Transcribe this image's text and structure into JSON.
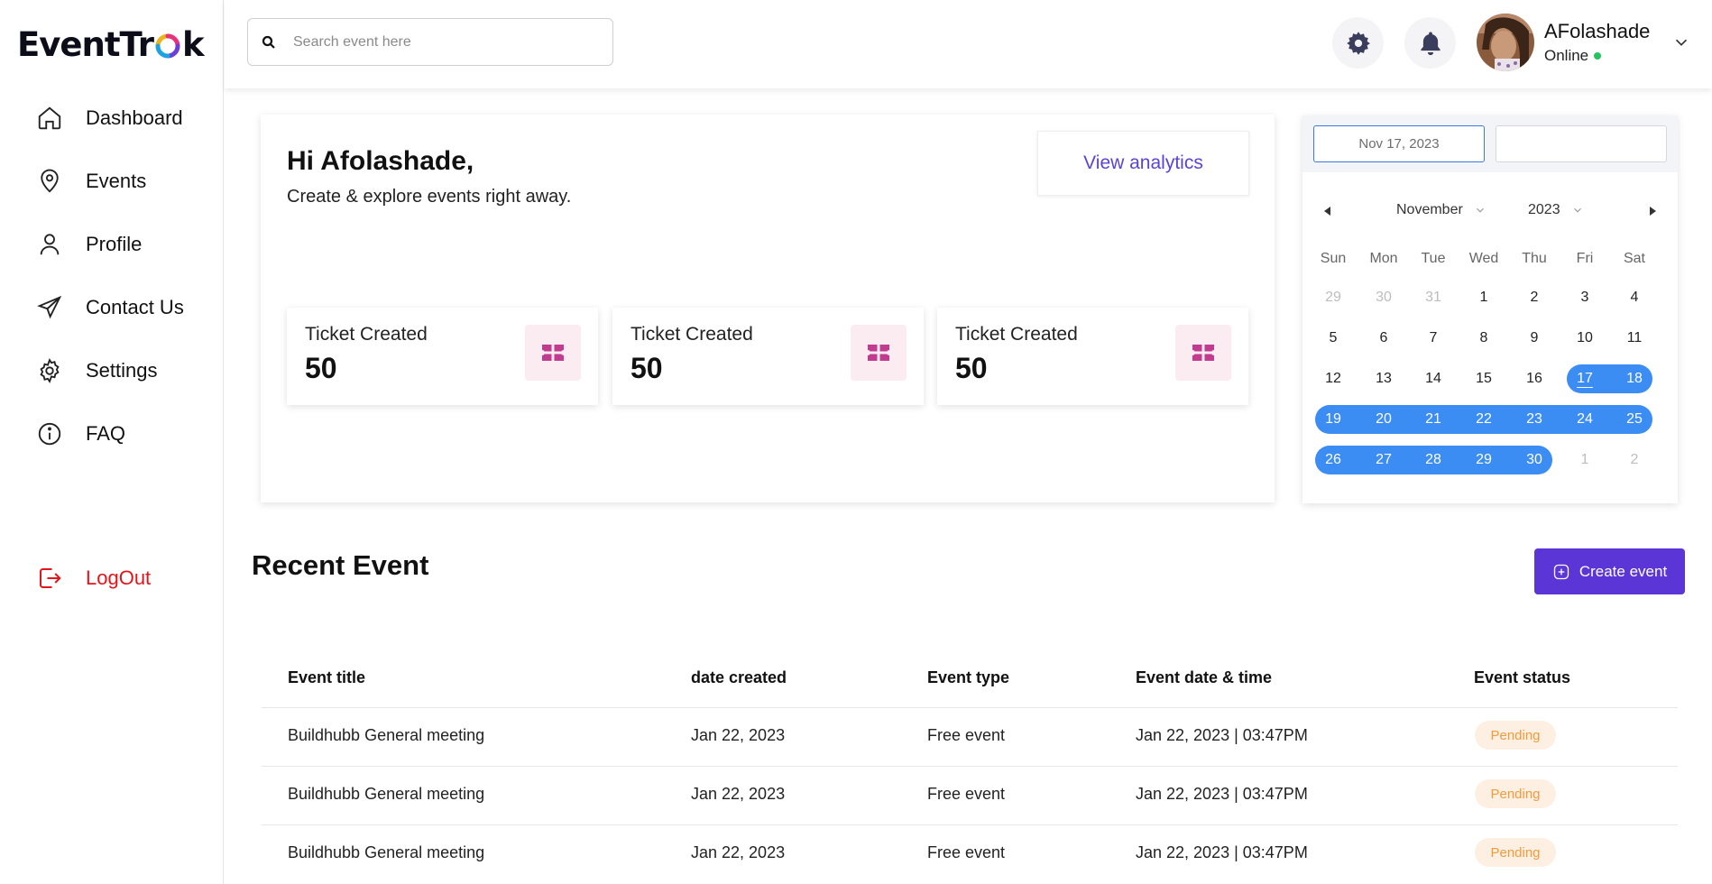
{
  "app": {
    "brand": "EventTrak",
    "brand_prefix": "EventTr",
    "brand_suffix": "k",
    "accent": "#5b35d5",
    "danger": "#e4141a"
  },
  "sidebar": {
    "items": [
      {
        "label": "Dashboard",
        "icon": "home-icon"
      },
      {
        "label": "Events",
        "icon": "location-pin-icon"
      },
      {
        "label": "Profile",
        "icon": "user-icon"
      },
      {
        "label": "Contact Us",
        "icon": "send-icon"
      },
      {
        "label": "Settings",
        "icon": "gear-icon"
      },
      {
        "label": "FAQ",
        "icon": "info-icon"
      }
    ],
    "logout": {
      "label": "LogOut",
      "icon": "logout-icon"
    }
  },
  "header": {
    "search_placeholder": "Search event here",
    "user_name": "AFolashade",
    "user_status": "Online",
    "status_color": "#22c55e"
  },
  "welcome": {
    "greeting": "Hi Afolashade,",
    "subtitle": "Create & explore events right away.",
    "analytics_label": "View analytics",
    "stats": [
      {
        "label": "Ticket Created",
        "value": "50",
        "icon": "ticket-icon"
      },
      {
        "label": "Ticket Created",
        "value": "50",
        "icon": "ticket-icon"
      },
      {
        "label": "Ticket Created",
        "value": "50",
        "icon": "ticket-icon"
      }
    ]
  },
  "calendar": {
    "start_input": "Nov 17, 2023",
    "end_input": "",
    "month": "November",
    "year": "2023",
    "weekdays": [
      "Sun",
      "Mon",
      "Tue",
      "Wed",
      "Thu",
      "Fri",
      "Sat"
    ],
    "weeks": [
      [
        "29",
        "30",
        "31",
        "1",
        "2",
        "3",
        "4"
      ],
      [
        "5",
        "6",
        "7",
        "8",
        "9",
        "10",
        "11"
      ],
      [
        "12",
        "13",
        "14",
        "15",
        "16",
        "17",
        "18"
      ],
      [
        "19",
        "20",
        "21",
        "22",
        "23",
        "24",
        "25"
      ],
      [
        "26",
        "27",
        "28",
        "29",
        "30",
        "1",
        "2"
      ]
    ],
    "selection_color": "#3b8cf3"
  },
  "recent": {
    "title": "Recent Event",
    "create_label": "Create event",
    "columns": [
      "Event title",
      "date created",
      "Event type",
      "Event date & time",
      "Event status"
    ],
    "rows": [
      {
        "title": "Buildhubb General meeting",
        "created": "Jan 22, 2023",
        "type": "Free event",
        "datetime": "Jan 22, 2023 | 03:47PM",
        "status": "Pending"
      },
      {
        "title": "Buildhubb General meeting",
        "created": "Jan 22, 2023",
        "type": "Free event",
        "datetime": "Jan 22, 2023 | 03:47PM",
        "status": "Pending"
      },
      {
        "title": "Buildhubb General meeting",
        "created": "Jan 22, 2023",
        "type": "Free event",
        "datetime": "Jan 22, 2023 | 03:47PM",
        "status": "Pending"
      }
    ]
  }
}
